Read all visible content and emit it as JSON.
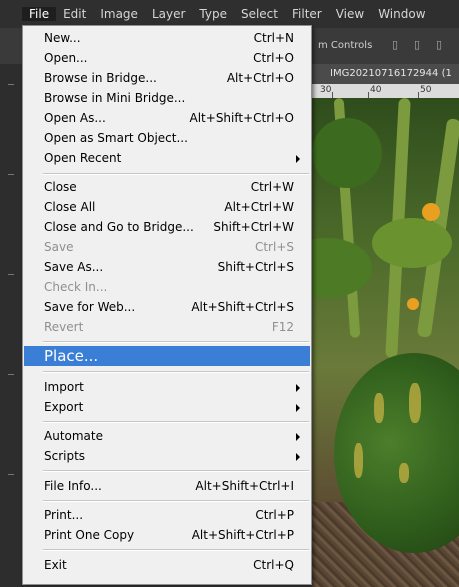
{
  "menubar": {
    "items": [
      "File",
      "Edit",
      "Image",
      "Layer",
      "Type",
      "Select",
      "Filter",
      "View",
      "Window"
    ]
  },
  "options_bar": {
    "text": "m Controls"
  },
  "document": {
    "tab_title": "IMG20210716172944 (1",
    "ruler_labels": [
      "30",
      "40",
      "50"
    ]
  },
  "file_menu": {
    "items": [
      {
        "label": "New...",
        "shortcut": "Ctrl+N"
      },
      {
        "label": "Open...",
        "shortcut": "Ctrl+O"
      },
      {
        "label": "Browse in Bridge...",
        "shortcut": "Alt+Ctrl+O"
      },
      {
        "label": "Browse in Mini Bridge...",
        "shortcut": ""
      },
      {
        "label": "Open As...",
        "shortcut": "Alt+Shift+Ctrl+O"
      },
      {
        "label": "Open as Smart Object...",
        "shortcut": ""
      },
      {
        "label": "Open Recent",
        "shortcut": ""
      },
      {
        "label": "Close",
        "shortcut": "Ctrl+W"
      },
      {
        "label": "Close All",
        "shortcut": "Alt+Ctrl+W"
      },
      {
        "label": "Close and Go to Bridge...",
        "shortcut": "Shift+Ctrl+W"
      },
      {
        "label": "Save",
        "shortcut": "Ctrl+S"
      },
      {
        "label": "Save As...",
        "shortcut": "Shift+Ctrl+S"
      },
      {
        "label": "Check In...",
        "shortcut": ""
      },
      {
        "label": "Save for Web...",
        "shortcut": "Alt+Shift+Ctrl+S"
      },
      {
        "label": "Revert",
        "shortcut": "F12"
      },
      {
        "label": "Place...",
        "shortcut": ""
      },
      {
        "label": "Import",
        "shortcut": ""
      },
      {
        "label": "Export",
        "shortcut": ""
      },
      {
        "label": "Automate",
        "shortcut": ""
      },
      {
        "label": "Scripts",
        "shortcut": ""
      },
      {
        "label": "File Info...",
        "shortcut": "Alt+Shift+Ctrl+I"
      },
      {
        "label": "Print...",
        "shortcut": "Ctrl+P"
      },
      {
        "label": "Print One Copy",
        "shortcut": "Alt+Shift+Ctrl+P"
      },
      {
        "label": "Exit",
        "shortcut": "Ctrl+Q"
      }
    ]
  },
  "colors": {
    "highlight": "#3a7fd5",
    "menu_bg": "#f0f0f0",
    "disabled_text": "#8f8f8f"
  }
}
